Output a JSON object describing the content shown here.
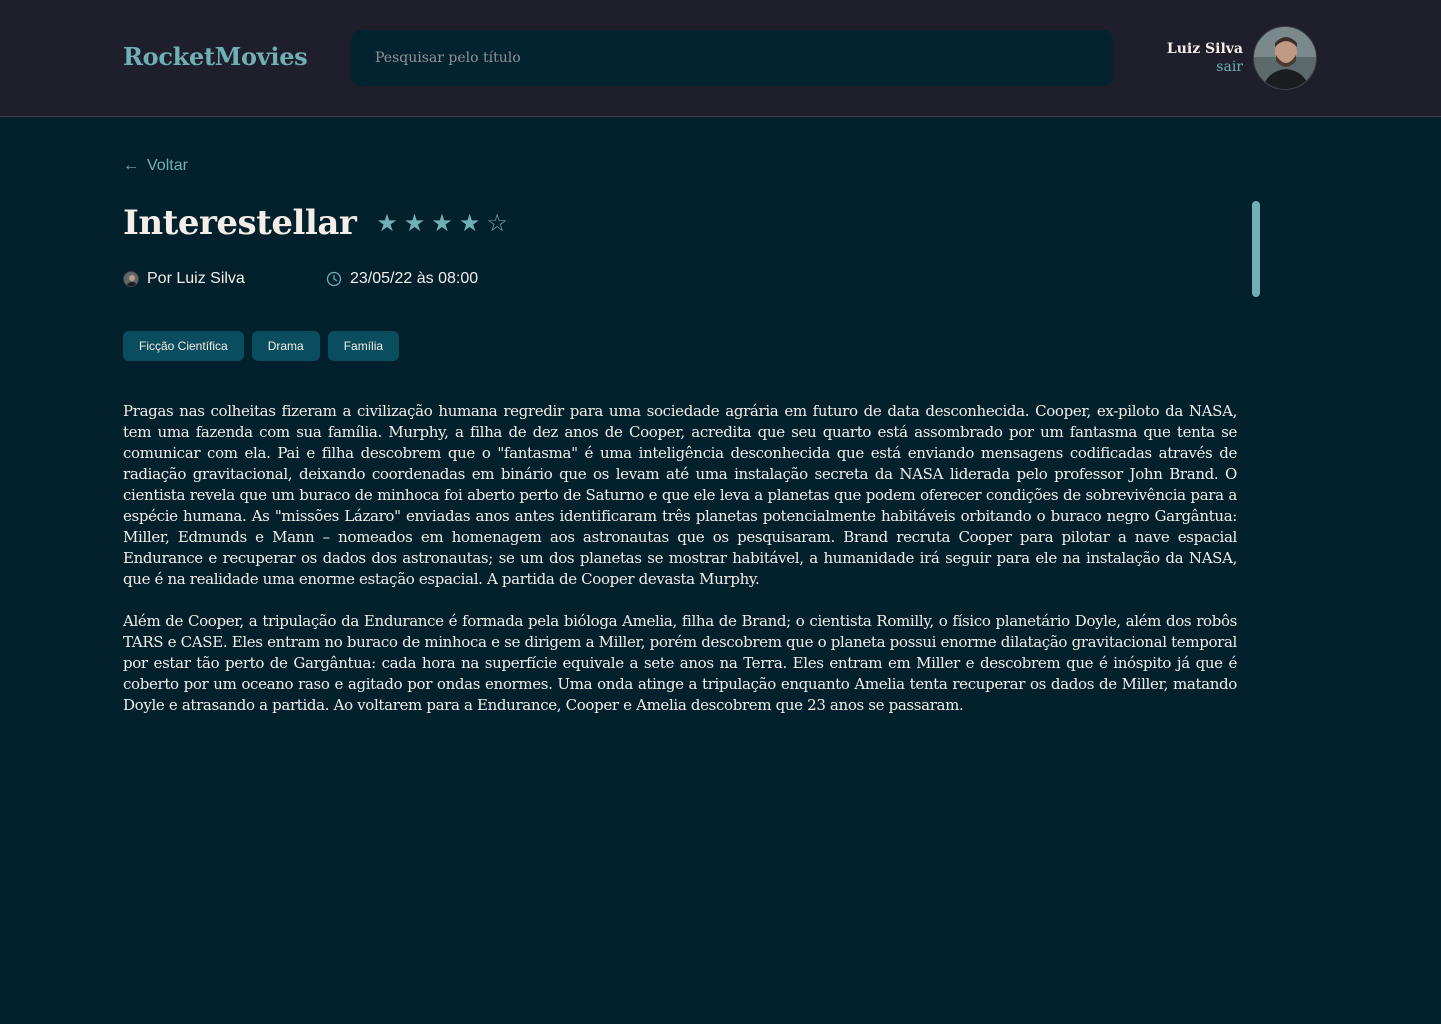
{
  "header": {
    "logo": "RocketMovies",
    "search_placeholder": "Pesquisar pelo título",
    "user_name": "Luiz Silva",
    "logout_label": "sair"
  },
  "back_label": "Voltar",
  "movie": {
    "title": "Interestellar",
    "rating": 4,
    "rating_max": 5,
    "author": "Por Luiz Silva",
    "date": "23/05/22 às 08:00",
    "tags": [
      "Ficção Científica",
      "Drama",
      "Família"
    ],
    "paragraphs": [
      "Pragas nas colheitas fizeram a civilização humana regredir para uma sociedade agrária em futuro de data desconhecida. Cooper, ex-piloto da NASA, tem uma fazenda com sua família. Murphy, a filha de dez anos de Cooper, acredita que seu quarto está assombrado por um fantasma que tenta se comunicar com ela. Pai e filha descobrem que o \"fantasma\" é uma inteligência desconhecida que está enviando mensagens codificadas através de radiação gravitacional, deixando coordenadas em binário que os levam até uma instalação secreta da NASA liderada pelo professor John Brand. O cientista revela que um buraco de minhoca foi aberto perto de Saturno e que ele leva a planetas que podem oferecer condições de sobrevivência para a espécie humana. As \"missões Lázaro\" enviadas anos antes identificaram três planetas potencialmente habitáveis orbitando o buraco negro Gargântua: Miller, Edmunds e Mann – nomeados em homenagem aos astronautas que os pesquisaram. Brand recruta Cooper para pilotar a nave espacial Endurance e recuperar os dados dos astronautas; se um dos planetas se mostrar habitável, a humanidade irá seguir para ele na instalação da NASA, que é na realidade uma enorme estação espacial. A partida de Cooper devasta Murphy.",
      "Além de Cooper, a tripulação da Endurance é formada pela bióloga Amelia, filha de Brand; o cientista Romilly, o físico planetário Doyle, além dos robôs TARS e CASE. Eles entram no buraco de minhoca e se dirigem a Miller, porém descobrem que o planeta possui enorme dilatação gravitacional temporal por estar tão perto de Gargântua: cada hora na superfície equivale a sete anos na Terra. Eles entram em Miller e descobrem que é inóspito já que é coberto por um oceano raso e agitado por ondas enormes. Uma onda atinge a tripulação enquanto Amelia tenta recuperar os dados de Miller, matando Doyle e atrasando a partida. Ao voltarem para a Endurance, Cooper e Amelia descobrem que 23 anos se passaram."
    ]
  },
  "colors": {
    "accent": "#6FAFB5",
    "background": "#03202D",
    "header_bg": "#1E1F2B",
    "tag_bg": "#0A4D5E",
    "text": "#F4EDE8"
  },
  "icons": {
    "back": "arrow-left-icon",
    "star_filled": "star-filled-icon",
    "star_empty": "star-outline-icon",
    "clock": "clock-icon"
  }
}
